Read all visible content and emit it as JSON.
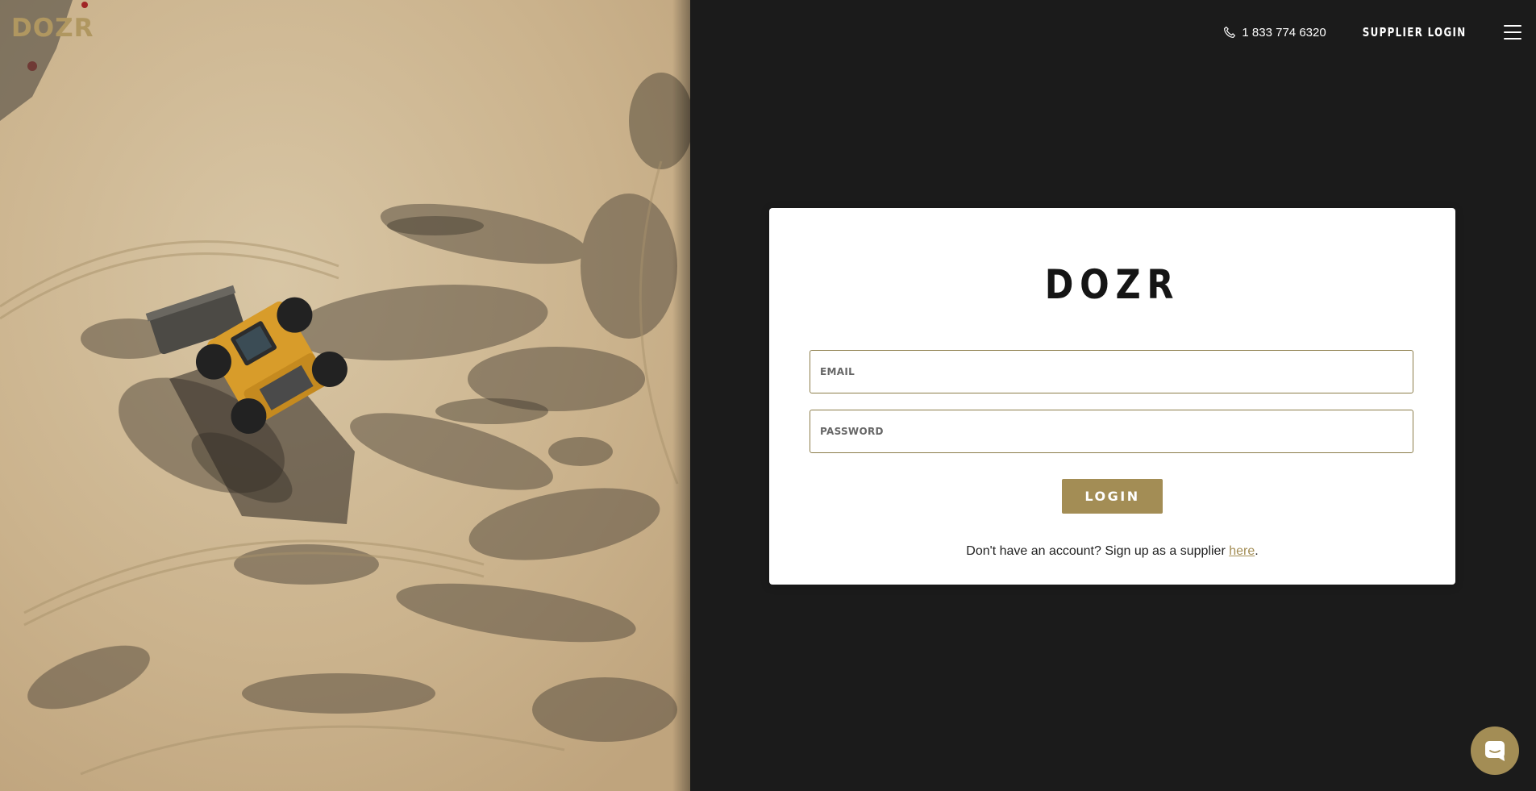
{
  "brand": {
    "logo_text": "DOZR",
    "logo_color": "#b09760"
  },
  "nav": {
    "phone_icon": "phone-icon",
    "phone_number": "1 833 774 6320",
    "supplier_login": "SUPPLIER LOGIN",
    "menu_icon": "hamburger-menu-icon"
  },
  "login_card": {
    "title": "DOZR",
    "email": {
      "placeholder": "EMAIL",
      "value": ""
    },
    "password": {
      "placeholder": "PASSWORD",
      "value": ""
    },
    "login_button": "LOGIN",
    "signup_prefix": "Don't have an account? Sign up as a supplier ",
    "signup_link": "here",
    "signup_suffix": "."
  },
  "chat": {
    "icon": "chat-bubble-icon"
  },
  "colors": {
    "background": "#1b1b1b",
    "accent": "#a38d55",
    "card": "#ffffff"
  }
}
